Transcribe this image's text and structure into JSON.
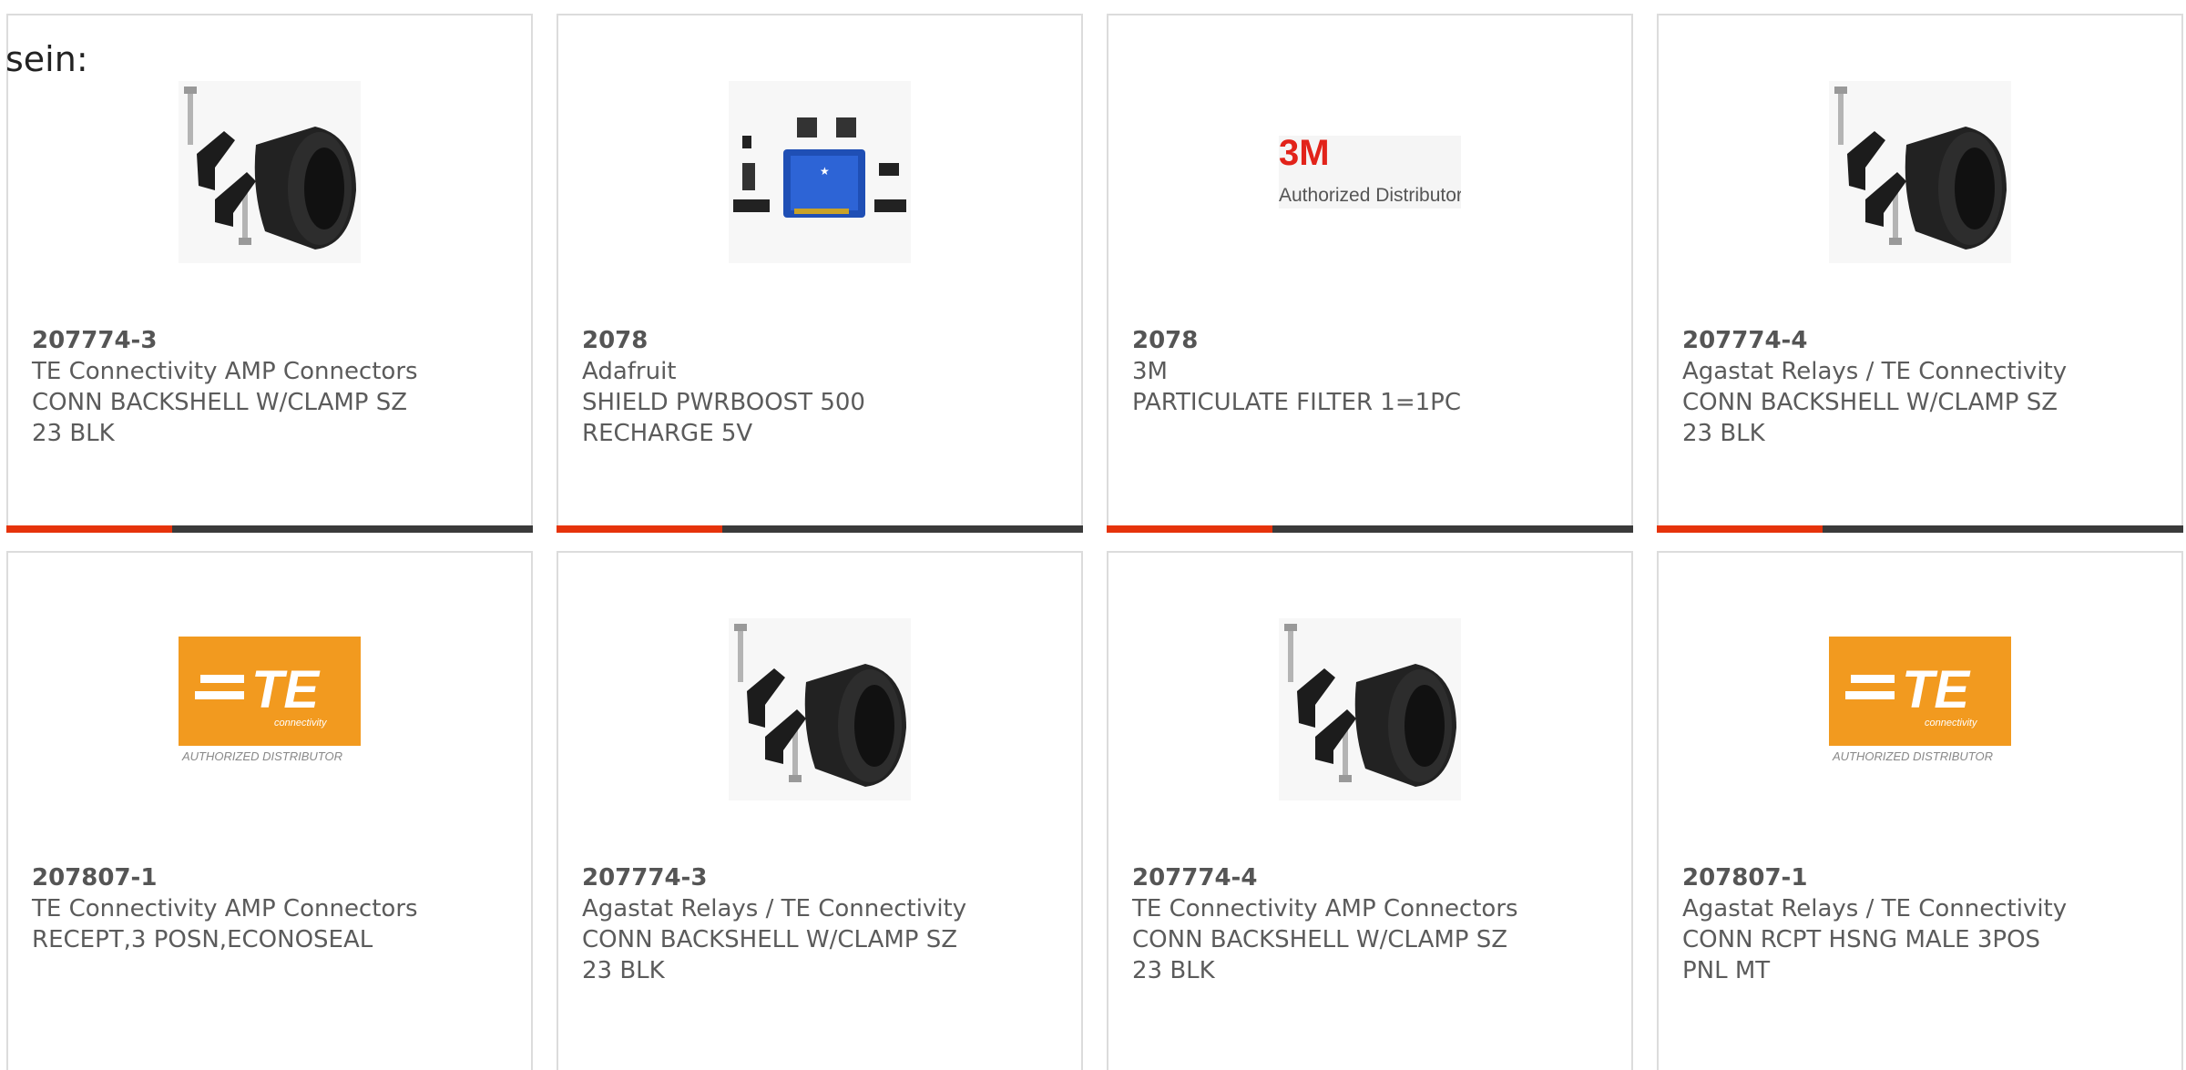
{
  "intro_text": "sein:",
  "accent_color": "#e6330b",
  "cards": [
    {
      "part": "207774-3",
      "manufacturer": "TE Connectivity AMP Connectors",
      "desc1": "CONN BACKSHELL W/CLAMP SZ",
      "desc2": "23 BLK",
      "image": "backshell-clamp"
    },
    {
      "part": "2078",
      "manufacturer": "Adafruit",
      "desc1": "SHIELD PWRBOOST 500",
      "desc2": "RECHARGE 5V",
      "image": "shield-board"
    },
    {
      "part": "2078",
      "manufacturer": "3M",
      "desc1": "PARTICULATE FILTER 1=1PC",
      "desc2": "",
      "image": "3m-logo",
      "logo_text": "3M",
      "logo_sub": "Authorized Distributor"
    },
    {
      "part": "207774-4",
      "manufacturer": "Agastat Relays / TE Connectivity",
      "desc1": "CONN BACKSHELL W/CLAMP SZ",
      "desc2": "23 BLK",
      "image": "backshell-clamp"
    },
    {
      "part": "207807-1",
      "manufacturer": "TE Connectivity AMP Connectors",
      "desc1": "RECEPT,3 POSN,ECONOSEAL",
      "desc2": "",
      "image": "te-logo",
      "logo_text": "TE",
      "logo_small": "connectivity",
      "logo_sub": "AUTHORIZED DISTRIBUTOR"
    },
    {
      "part": "207774-3",
      "manufacturer": "Agastat Relays / TE Connectivity",
      "desc1": "CONN BACKSHELL W/CLAMP SZ",
      "desc2": "23 BLK",
      "image": "backshell-clamp"
    },
    {
      "part": "207774-4",
      "manufacturer": "TE Connectivity AMP Connectors",
      "desc1": "CONN BACKSHELL W/CLAMP SZ",
      "desc2": "23 BLK",
      "image": "backshell-clamp"
    },
    {
      "part": "207807-1",
      "manufacturer": "Agastat Relays / TE Connectivity",
      "desc1": "CONN RCPT HSNG MALE 3POS",
      "desc2": "PNL MT",
      "image": "te-logo",
      "logo_text": "TE",
      "logo_small": "connectivity",
      "logo_sub": "AUTHORIZED DISTRIBUTOR"
    }
  ]
}
